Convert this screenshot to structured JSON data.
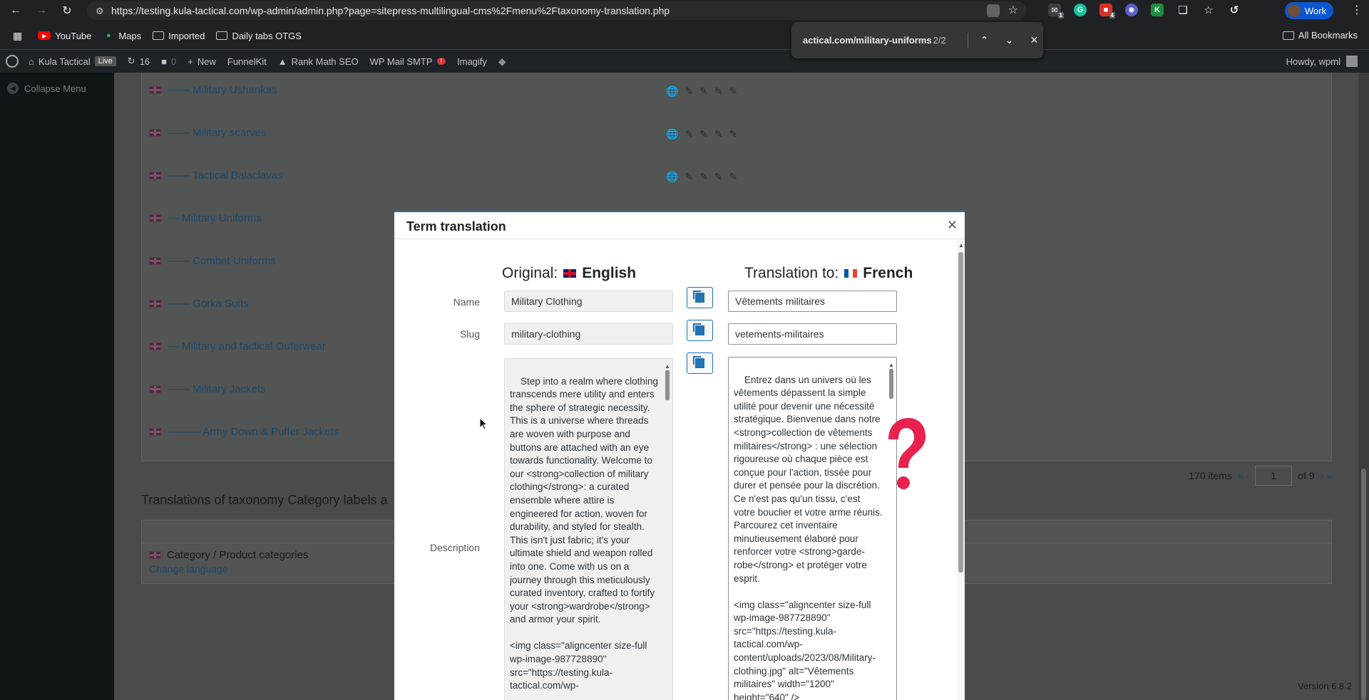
{
  "browser": {
    "url": "https://testing.kula-tactical.com/wp-admin/admin.php?page=sitepress-multilingual-cms%2Fmenu%2Ftaxonomy-translation.php",
    "profile": "Work",
    "ext_badges": [
      "1",
      "4"
    ],
    "bookmarks": [
      {
        "label": "YouTube",
        "icon": "youtube-icon"
      },
      {
        "label": "Maps",
        "icon": "maps-pin-icon"
      },
      {
        "label": "Imported",
        "icon": "folder-icon"
      },
      {
        "label": "Daily tabs OTGS",
        "icon": "folder-icon"
      }
    ],
    "all_bookmarks": "All Bookmarks"
  },
  "find": {
    "query": "actical.com/military-uniforms",
    "count": "2/2"
  },
  "wpbar": {
    "site": "Kula Tactical",
    "live": "Live",
    "updates": "16",
    "comments": "0",
    "new": "New",
    "funnelkit": "FunnelKit",
    "rankmath": "Rank Math SEO",
    "smtp": "WP Mail SMTP",
    "smtp_badge": "!",
    "imagify": "Imagify",
    "howdy": "Howdy, wpml"
  },
  "menu": {
    "collapse": "Collapse Menu"
  },
  "terms": [
    {
      "label": "—— Military Ushankas",
      "icons": true
    },
    {
      "label": "—— Military scarves",
      "icons": true
    },
    {
      "label": "—— Tactical Balaclavas",
      "icons": true
    },
    {
      "label": "— Military Uniforms",
      "icons": false
    },
    {
      "label": "—— Combat Uniforms",
      "icons": false
    },
    {
      "label": "—— Gorka Suits",
      "icons": false
    },
    {
      "label": "— Military and tactical Outerwear",
      "icons": false
    },
    {
      "label": "—— Military Jackets",
      "icons": false
    },
    {
      "label": "——— Army Down & Puffer Jackets",
      "icons": false
    }
  ],
  "pager": {
    "items": "170 items",
    "prev": "« ‹",
    "page": "1",
    "of": "of 9",
    "next": "› »"
  },
  "section_title": "Translations of taxonomy Category labels a",
  "category_line": "Category / Product categories",
  "change_language": "Change language",
  "version": "Version 6.8.2",
  "modal": {
    "title": "Term translation",
    "original_label": "Original:",
    "original_lang": "English",
    "translation_label": "Translation to:",
    "translation_lang": "French",
    "name_label": "Name",
    "slug_label": "Slug",
    "description_label": "Description",
    "name_original": "Military Clothing",
    "name_translation": "Vêtements militaires",
    "slug_original": "military-clothing",
    "slug_translation": "vetements-militaires",
    "desc_original": "Step into a realm where clothing transcends mere utility and enters the sphere of strategic necessity. This is a universe where threads are woven with purpose and buttons are attached with an eye towards functionality. Welcome to our <strong>collection of military clothing</strong>: a curated ensemble where attire is engineered for action, woven for durability, and styled for stealth. This isn't just fabric; it's your ultimate shield and weapon rolled into one. Come with us on a journey through this meticulously curated inventory, crafted to fortify your <strong>wardrobe</strong> and armor your spirit.\n\n<img class=\"aligncenter size-full wp-image-987728890\" src=\"https://testing.kula-tactical.com/wp-",
    "desc_translation": "Entrez dans un univers où les vêtements dépassent la simple utilité pour devenir une nécessité stratégique. Bienvenue dans notre <strong>collection de vêtements militaires</strong> : une sélection rigoureuse où chaque pièce est conçue pour l'action, tissée pour durer et pensée pour la discrétion. Ce n'est pas qu'un tissu, c'est votre bouclier et votre arme réunis. Parcourez cet inventaire minutieusement élaboré pour renforcer votre <strong>garde-robe</strong> et protéger votre esprit.\n\n<img class=\"aligncenter size-full wp-image-987728890\" src=\"https://testing.kula-tactical.com/wp-content/uploads/2023/08/Military-clothing.jpg\" alt=\"Vêtements militaires\" width=\"1200\" height=\"640\" />"
  },
  "colors": {
    "accent": "#2271b1",
    "question_mark": "#e8214f"
  }
}
